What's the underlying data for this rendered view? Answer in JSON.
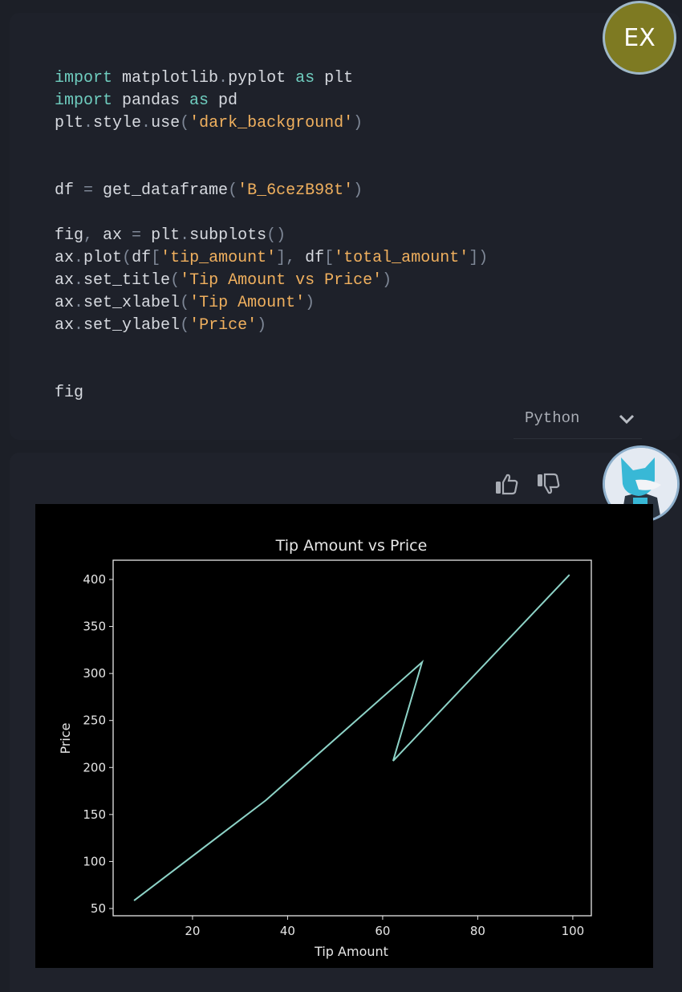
{
  "code_cell": {
    "lines": [
      [
        [
          "import",
          "kw"
        ],
        [
          " matplotlib",
          "plain"
        ],
        [
          ".",
          "punc"
        ],
        [
          "pyplot ",
          "plain"
        ],
        [
          "as",
          "kw"
        ],
        [
          " plt",
          "plain"
        ]
      ],
      [
        [
          "import",
          "kw"
        ],
        [
          " pandas ",
          "plain"
        ],
        [
          "as",
          "kw"
        ],
        [
          " pd",
          "plain"
        ]
      ],
      [
        [
          "plt",
          "plain"
        ],
        [
          ".",
          "punc"
        ],
        [
          "style",
          "plain"
        ],
        [
          ".",
          "punc"
        ],
        [
          "use",
          "plain"
        ],
        [
          "(",
          "punc"
        ],
        [
          "'dark_background'",
          "str"
        ],
        [
          ")",
          "punc"
        ]
      ],
      [],
      [],
      [
        [
          "df ",
          "plain"
        ],
        [
          "=",
          "punc"
        ],
        [
          " get_dataframe",
          "plain"
        ],
        [
          "(",
          "punc"
        ],
        [
          "'B_6cezB98t'",
          "str"
        ],
        [
          ")",
          "punc"
        ]
      ],
      [],
      [
        [
          "fig",
          "plain"
        ],
        [
          ",",
          "punc"
        ],
        [
          " ax ",
          "plain"
        ],
        [
          "=",
          "punc"
        ],
        [
          " plt",
          "plain"
        ],
        [
          ".",
          "punc"
        ],
        [
          "subplots",
          "plain"
        ],
        [
          "()",
          "punc"
        ]
      ],
      [
        [
          "ax",
          "plain"
        ],
        [
          ".",
          "punc"
        ],
        [
          "plot",
          "plain"
        ],
        [
          "(",
          "punc"
        ],
        [
          "df",
          "plain"
        ],
        [
          "[",
          "punc"
        ],
        [
          "'tip_amount'",
          "str"
        ],
        [
          "],",
          "punc"
        ],
        [
          " df",
          "plain"
        ],
        [
          "[",
          "punc"
        ],
        [
          "'total_amount'",
          "str"
        ],
        [
          "])",
          "punc"
        ]
      ],
      [
        [
          "ax",
          "plain"
        ],
        [
          ".",
          "punc"
        ],
        [
          "set_title",
          "plain"
        ],
        [
          "(",
          "punc"
        ],
        [
          "'Tip Amount vs Price'",
          "str"
        ],
        [
          ")",
          "punc"
        ]
      ],
      [
        [
          "ax",
          "plain"
        ],
        [
          ".",
          "punc"
        ],
        [
          "set_xlabel",
          "plain"
        ],
        [
          "(",
          "punc"
        ],
        [
          "'Tip Amount'",
          "str"
        ],
        [
          ")",
          "punc"
        ]
      ],
      [
        [
          "ax",
          "plain"
        ],
        [
          ".",
          "punc"
        ],
        [
          "set_ylabel",
          "plain"
        ],
        [
          "(",
          "punc"
        ],
        [
          "'Price'",
          "str"
        ],
        [
          ")",
          "punc"
        ]
      ],
      [],
      [],
      [
        [
          "fig",
          "plain"
        ]
      ]
    ],
    "language": "Python"
  },
  "user_avatar": {
    "initials": "EX",
    "color": "#7e7a22"
  },
  "feedback": {
    "thumbs_up": "thumbs-up-icon",
    "thumbs_down": "thumbs-down-icon"
  },
  "chart_data": {
    "type": "line",
    "title": "Tip Amount vs Price",
    "xlabel": "Tip Amount",
    "ylabel": "Price",
    "xlim": [
      3.3,
      103.9
    ],
    "ylim": [
      42.3,
      420.5
    ],
    "xticks": [
      20,
      40,
      60,
      80,
      100
    ],
    "yticks": [
      50,
      100,
      150,
      200,
      250,
      300,
      350,
      400
    ],
    "grid": false,
    "line_color": "#8dd3c7",
    "background": "#000000",
    "x": [
      7.7,
      35.4,
      68.3,
      62.2,
      99.3
    ],
    "y": [
      58.5,
      165,
      312,
      207,
      405
    ]
  }
}
